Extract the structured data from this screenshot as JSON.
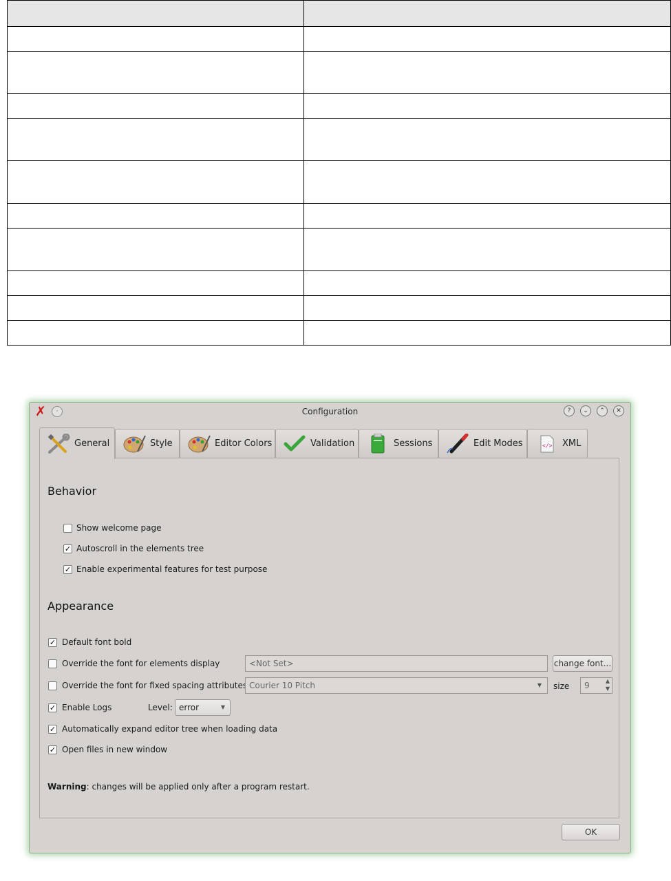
{
  "dialog": {
    "title": "Configuration",
    "tabs": [
      "General",
      "Style",
      "Editor Colors",
      "Validation",
      "Sessions",
      "Edit Modes",
      "XML"
    ],
    "active_tab": "General",
    "behavior": {
      "heading": "Behavior",
      "options": [
        {
          "label": "Show welcome page",
          "checked": false
        },
        {
          "label": "Autoscroll in the elements tree",
          "checked": true
        },
        {
          "label": "Enable experimental features for test purpose",
          "checked": true
        }
      ]
    },
    "appearance": {
      "heading": "Appearance",
      "default_font_bold": {
        "label": "Default font bold",
        "checked": true
      },
      "override_elements_font": {
        "label": "Override the font for elements display",
        "checked": false,
        "value": "<Not Set>",
        "button": "change font..."
      },
      "override_fixed_font": {
        "label": "Override the font for fixed spacing attributes",
        "checked": false,
        "font": "Courier 10 Pitch",
        "size_label": "size",
        "size": "9"
      },
      "enable_logs": {
        "label": "Enable Logs",
        "checked": true,
        "level_label": "Level:",
        "level": "error"
      },
      "auto_expand": {
        "label": "Automatically expand editor tree when loading data",
        "checked": true
      },
      "open_new_window": {
        "label": "Open files in new window",
        "checked": true
      }
    },
    "warning": {
      "bold": "Warning",
      "text": ": changes will be applied only after a program restart."
    },
    "ok_button": "OK",
    "check_mark": "✓",
    "window_buttons": {
      "help": "?",
      "minimize": "⌄",
      "maximize": "⌃",
      "close": "✕",
      "menu": "·"
    },
    "app_icon": "✗",
    "combo_arrow": "▼",
    "spin_up": "▲",
    "spin_down": "▼",
    "accent_green": "#3aa53a"
  }
}
